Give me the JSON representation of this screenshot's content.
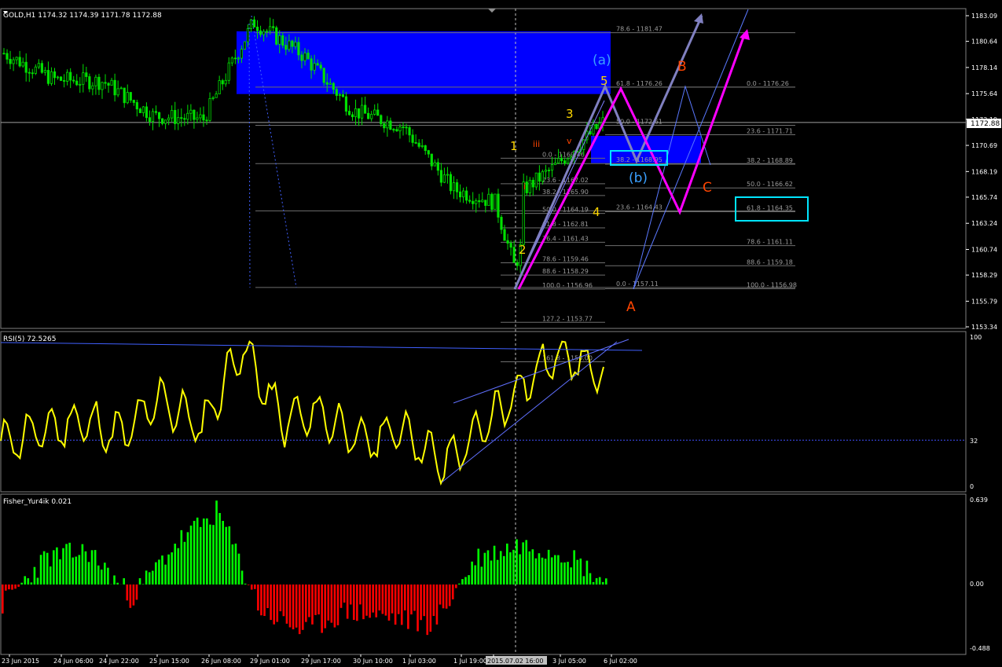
{
  "symbol_header": "GOLD,H1  1174.32 1174.39 1171.78 1172.88",
  "current_price": "1172.88",
  "price_axis": [
    "1183.09",
    "1180.64",
    "1178.14",
    "1175.64",
    "1173.19",
    "1170.69",
    "1168.19",
    "1165.74",
    "1163.24",
    "1160.74",
    "1158.29",
    "1155.79",
    "1153.34"
  ],
  "time_axis": [
    "23 Jun 2015",
    "24 Jun 06:00",
    "24 Jun 22:00",
    "25 Jun 15:00",
    "26 Jun 08:00",
    "29 Jun 01:00",
    "29 Jun 17:00",
    "30 Jun 10:00",
    "1 Jul 03:00",
    "1 Jul 19:00",
    "2015.07.02 16:00",
    "3 Jul 05:00",
    "6 Jul 02:00"
  ],
  "fib_left": [
    "0.0 - 1169.46",
    "23.6 - 1167.02",
    "38.2 - 1165.90",
    "50.0 - 1164.19",
    "61.8 - 1162.81",
    "76.4 - 1161.43",
    "78.6 - 1159.46",
    "88.6 - 1158.29",
    "100.0 - 1156.96",
    "127.2 - 1153.77",
    "161.8 - 1150.00"
  ],
  "fib_mid": [
    "78.6 - 1181.47",
    "61.8 - 1176.26",
    "50.0 - 1172.61",
    "38.2 - 1168.95",
    "23.6 - 1164.43",
    "0.0 - 1157.11"
  ],
  "fib_right": [
    "0.0 - 1176.26",
    "23.6 - 1171.71",
    "38.2 - 1168.89",
    "50.0 - 1166.62",
    "61.8 - 1164.35",
    "78.6 - 1161.11",
    "88.6 - 1159.18",
    "100.0 - 1156.98"
  ],
  "wave_labels": {
    "w1": "1",
    "w2": "2",
    "w3": "3",
    "w4": "4",
    "w5": "5",
    "wi": "i",
    "wiii": "iii",
    "wv": "v",
    "wa": "(a)",
    "wb": "(b)",
    "A": "A",
    "B": "B",
    "C": "C"
  },
  "rsi": {
    "label": "RSI(5) 72.5265",
    "levels": [
      "100",
      "32",
      "0"
    ]
  },
  "fisher": {
    "label": "Fisher_Yur4ik 0.021",
    "levels": [
      "0.639",
      "0.00",
      "-0.488"
    ]
  },
  "colors": {
    "candle": "#00e000",
    "rsi": "#ffff00",
    "fisher_pos": "#00ff00",
    "fisher_neg": "#ff0000",
    "zone": "#0000ff",
    "magenta": "#ff00ff",
    "projection": "#8080c0",
    "cyan": "#00e5ff",
    "wave_orange": "#ff4500",
    "wave_yellow": "#ffd700"
  },
  "chart_data": [
    {
      "type": "candlestick",
      "title": "GOLD,H1",
      "ylim": [
        1152.0,
        1184.0
      ],
      "x": [
        "23 Jun 2015",
        "24 Jun 06:00",
        "24 Jun 22:00",
        "25 Jun 15:00",
        "26 Jun 08:00",
        "29 Jun 01:00",
        "29 Jun 17:00",
        "30 Jun 10:00",
        "1 Jul 03:00",
        "1 Jul 19:00",
        "2015.07.02 16:00",
        "3 Jul 05:00",
        "6 Jul 02:00"
      ],
      "close_approx": [
        1179.5,
        1177.0,
        1176.8,
        1173.5,
        1173.2,
        1182.5,
        1179.3,
        1174.0,
        1172.5,
        1166.5,
        1165.0,
        1168.5,
        1172.88
      ]
    },
    {
      "type": "line",
      "title": "RSI(5) 72.5265",
      "ylim": [
        0,
        100
      ],
      "levels": [
        32
      ],
      "values_approx": [
        30,
        38,
        45,
        35,
        60,
        40,
        95,
        45,
        50,
        30,
        40,
        15,
        40,
        70,
        92,
        72.5
      ]
    },
    {
      "type": "bar",
      "title": "Fisher_Yur4ik 0.021",
      "ylim": [
        -0.488,
        0.639
      ],
      "values_approx": [
        -0.15,
        0.2,
        0.25,
        -0.1,
        0.3,
        0.55,
        -0.2,
        -0.35,
        -0.2,
        -0.25,
        -0.3,
        0.2,
        0.3,
        0.25,
        0.021
      ]
    }
  ]
}
